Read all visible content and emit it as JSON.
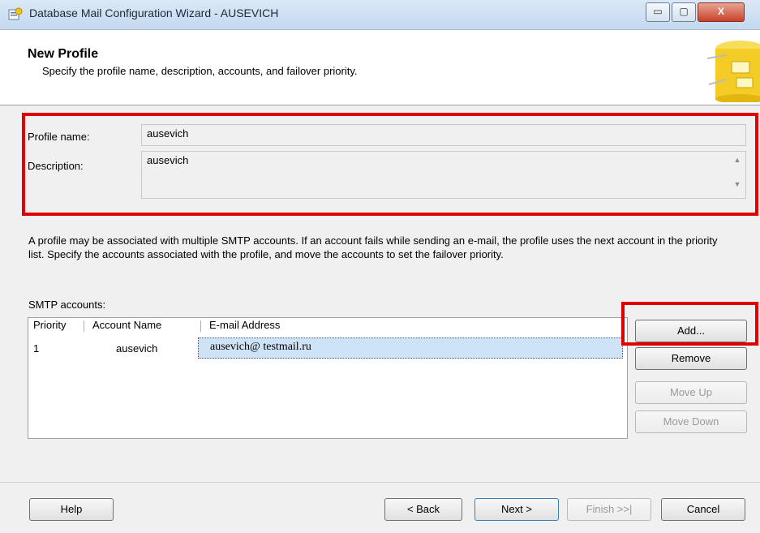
{
  "window": {
    "title": "Database Mail Configuration Wizard - AUSEVICH",
    "close_glyph": "X",
    "minimize_glyph": "▭",
    "maximize_glyph": "▢"
  },
  "header": {
    "title": "New Profile",
    "subtitle": "Specify the profile name, description, accounts, and failover priority."
  },
  "form": {
    "profile_name_label": "Profile name:",
    "profile_name_value": "ausevich",
    "description_label": "Description:",
    "description_value": "ausevich"
  },
  "info_text": "A profile may be associated with multiple SMTP accounts. If an account fails while sending an e-mail, the profile uses the next account in the priority list. Specify the accounts associated with the profile, and move the accounts to set the failover priority.",
  "smtp": {
    "label": "SMTP accounts:",
    "columns": [
      "Priority",
      "Account Name",
      "E-mail Address"
    ],
    "rows": [
      {
        "priority": "1",
        "account": "ausevich",
        "email": "ausevich@ testmail.ru"
      }
    ]
  },
  "side_buttons": {
    "add": "Add...",
    "remove": "Remove",
    "move_up": "Move Up",
    "move_down": "Move Down"
  },
  "footer": {
    "help": "Help",
    "back": "< Back",
    "next": "Next >",
    "finish": "Finish >>|",
    "cancel": "Cancel"
  },
  "colors": {
    "highlight": "#e00000",
    "selection": "#cfe3f7",
    "panel": "#f0f0f0"
  }
}
